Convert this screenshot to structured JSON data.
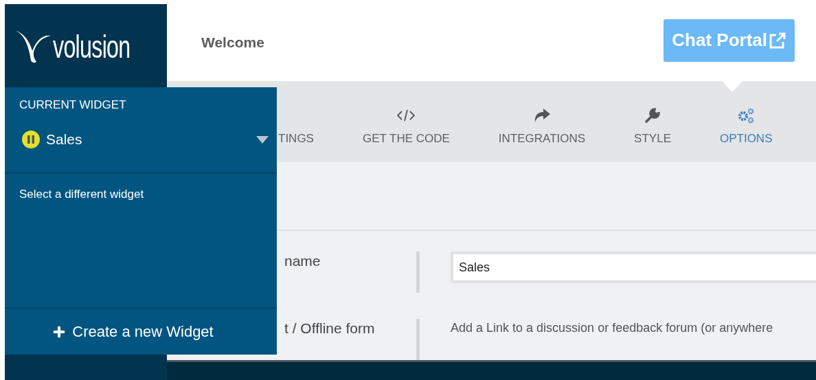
{
  "sidebar": {
    "logo": "volusion"
  },
  "header": {
    "title": "Welcome",
    "button": "Chat Portal"
  },
  "tabs": [
    {
      "label": "TINGS",
      "kind": "settings",
      "selected": false
    },
    {
      "label": "GET THE CODE",
      "kind": "code",
      "selected": false
    },
    {
      "label": "INTEGRATIONS",
      "kind": "share",
      "selected": false
    },
    {
      "label": "STYLE",
      "kind": "wrench",
      "selected": false
    },
    {
      "label": "OPTIONS",
      "kind": "gears",
      "selected": true
    }
  ],
  "form": {
    "rows": [
      {
        "label": "name",
        "kind": "input",
        "value": "Sales"
      },
      {
        "label": "t / Offline form",
        "kind": "text",
        "text": "Add a Link to a discussion or feedback forum (or anywhere"
      }
    ]
  },
  "widget_menu": {
    "heading": "CURRENT WIDGET",
    "current": {
      "name": "Sales",
      "paused": true
    },
    "hint": "Select a different widget",
    "create_button": "Create a new Widget"
  }
}
